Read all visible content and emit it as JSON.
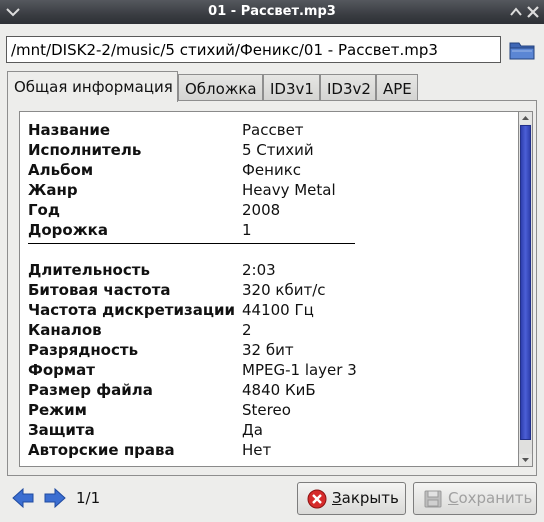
{
  "window": {
    "title": "01 - Рассвет.mp3"
  },
  "path": {
    "value": "/mnt/DISK2-2/music/5 стихий/Феникс/01 - Рассвет.mp3"
  },
  "tabs": [
    {
      "label": "Общая информация",
      "active": true
    },
    {
      "label": "Обложка"
    },
    {
      "label": "ID3v1"
    },
    {
      "label": "ID3v2"
    },
    {
      "label": "APE"
    }
  ],
  "tags": [
    {
      "label": "Название",
      "value": "Рассвет"
    },
    {
      "label": "Исполнитель",
      "value": "5 Стихий"
    },
    {
      "label": "Альбом",
      "value": "Феникс"
    },
    {
      "label": "Жанр",
      "value": "Heavy Metal"
    },
    {
      "label": "Год",
      "value": "2008"
    },
    {
      "label": "Дорожка",
      "value": "1"
    }
  ],
  "properties": [
    {
      "label": "Длительность",
      "value": "2:03"
    },
    {
      "label": "Битовая частота",
      "value": "320 кбит/с"
    },
    {
      "label": "Частота дискретизации",
      "value": "44100 Гц"
    },
    {
      "label": "Каналов",
      "value": "2"
    },
    {
      "label": "Разрядность",
      "value": "32 бит"
    },
    {
      "label": "Формат",
      "value": "MPEG-1 layer 3"
    },
    {
      "label": "Размер файла",
      "value": "4840 КиБ"
    },
    {
      "label": "Режим",
      "value": "Stereo"
    },
    {
      "label": "Защита",
      "value": "Да"
    },
    {
      "label": "Авторские права",
      "value": "Нет"
    }
  ],
  "pager": {
    "text": "1/1"
  },
  "buttons": {
    "close": {
      "mnemonic": "З",
      "rest": "акрыть"
    },
    "save": {
      "mnemonic": "С",
      "rest": "охранить",
      "enabled": false
    }
  },
  "colors": {
    "titlebar": "#3a3d42",
    "scroll_thumb": "#3a4cc8",
    "close_icon": "#d62b2b",
    "arrow": "#3b6ed1"
  },
  "icons": {
    "window_menu": "window-menu-icon",
    "maximize": "maximize-icon",
    "close": "window-close-icon",
    "browse": "folder-icon",
    "back": "arrow-left-icon",
    "forward": "arrow-right-icon",
    "close_button": "close-circle-icon",
    "save_button": "floppy-disk-icon"
  }
}
